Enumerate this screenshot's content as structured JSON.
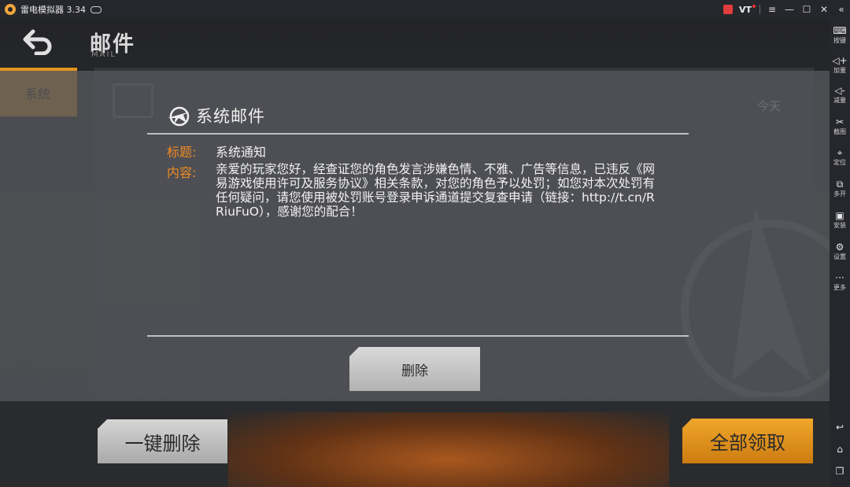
{
  "window": {
    "title": "雷电模拟器 3.34",
    "vt_label": "VT"
  },
  "sidebar": {
    "items": [
      {
        "label": "按键",
        "icon": "keyboard-icon"
      },
      {
        "label": "加量",
        "icon": "volume-up-icon"
      },
      {
        "label": "减量",
        "icon": "volume-down-icon"
      },
      {
        "label": "截图",
        "icon": "scissors-icon"
      },
      {
        "label": "定位",
        "icon": "location-pin-icon"
      },
      {
        "label": "多开",
        "icon": "multi-instance-icon"
      },
      {
        "label": "安装",
        "icon": "apk-install-icon"
      },
      {
        "label": "设置",
        "icon": "gear-icon"
      },
      {
        "label": "更多",
        "icon": "more-dots-icon"
      }
    ],
    "nav": [
      "back-icon",
      "home-icon",
      "recent-apps-icon"
    ]
  },
  "game": {
    "header": {
      "title": "邮件",
      "subtitle": "MAIL"
    },
    "tab": {
      "label": "系统"
    },
    "list": {
      "date_label": "今天"
    },
    "buttons": {
      "delete_all": "一键删除",
      "claim_all": "全部领取"
    }
  },
  "dialog": {
    "title": "系统邮件",
    "subject_label": "标题:",
    "subject_value": "系统通知",
    "content_label": "内容:",
    "content_value": "亲爱的玩家您好，经查证您的角色发言涉嫌色情、不雅、广告等信息，已违反《网易游戏使用许可及服务协议》相关条款，对您的角色予以处罚；如您对本次处罚有任何疑问，请您使用被处罚账号登录申诉通道提交复查申请（链接：http://t.cn/RRiuFuO），感谢您的配合！",
    "delete_button": "删除"
  },
  "colors": {
    "accent_orange": "#ef8a23",
    "tab_orange": "#e1951e"
  }
}
